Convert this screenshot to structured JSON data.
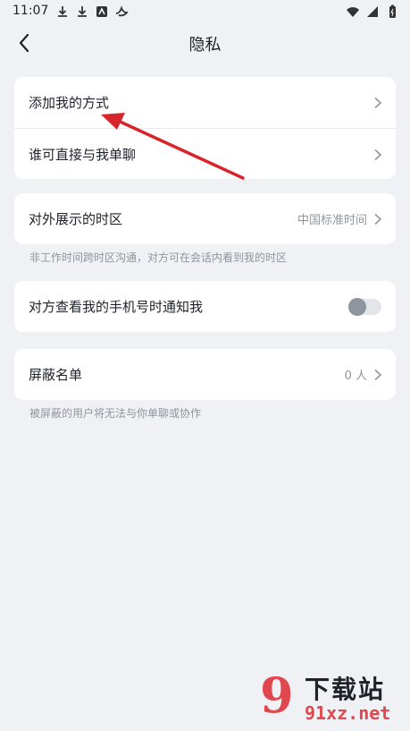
{
  "status": {
    "time": "11:07"
  },
  "header": {
    "title": "隐私"
  },
  "card1": {
    "rows": [
      {
        "label": "添加我的方式"
      },
      {
        "label": "谁可直接与我单聊"
      }
    ]
  },
  "timezone": {
    "label": "对外展示的时区",
    "value": "中国标准时间",
    "note": "非工作时间跨时区沟通，对方可在会话内看到我的时区"
  },
  "phone_notify": {
    "label": "对方查看我的手机号时通知我",
    "enabled": false
  },
  "blocklist": {
    "label": "屏蔽名单",
    "value": "0 人",
    "note": "被屏蔽的用户将无法与你单聊或协作"
  },
  "watermark": {
    "brand": "下载站",
    "url": "91xz.net",
    "logo": "9"
  },
  "colors": {
    "background": "#f0f1f4",
    "annotation_arrow": "#d8252b",
    "toggle_off": "#8f959e"
  }
}
